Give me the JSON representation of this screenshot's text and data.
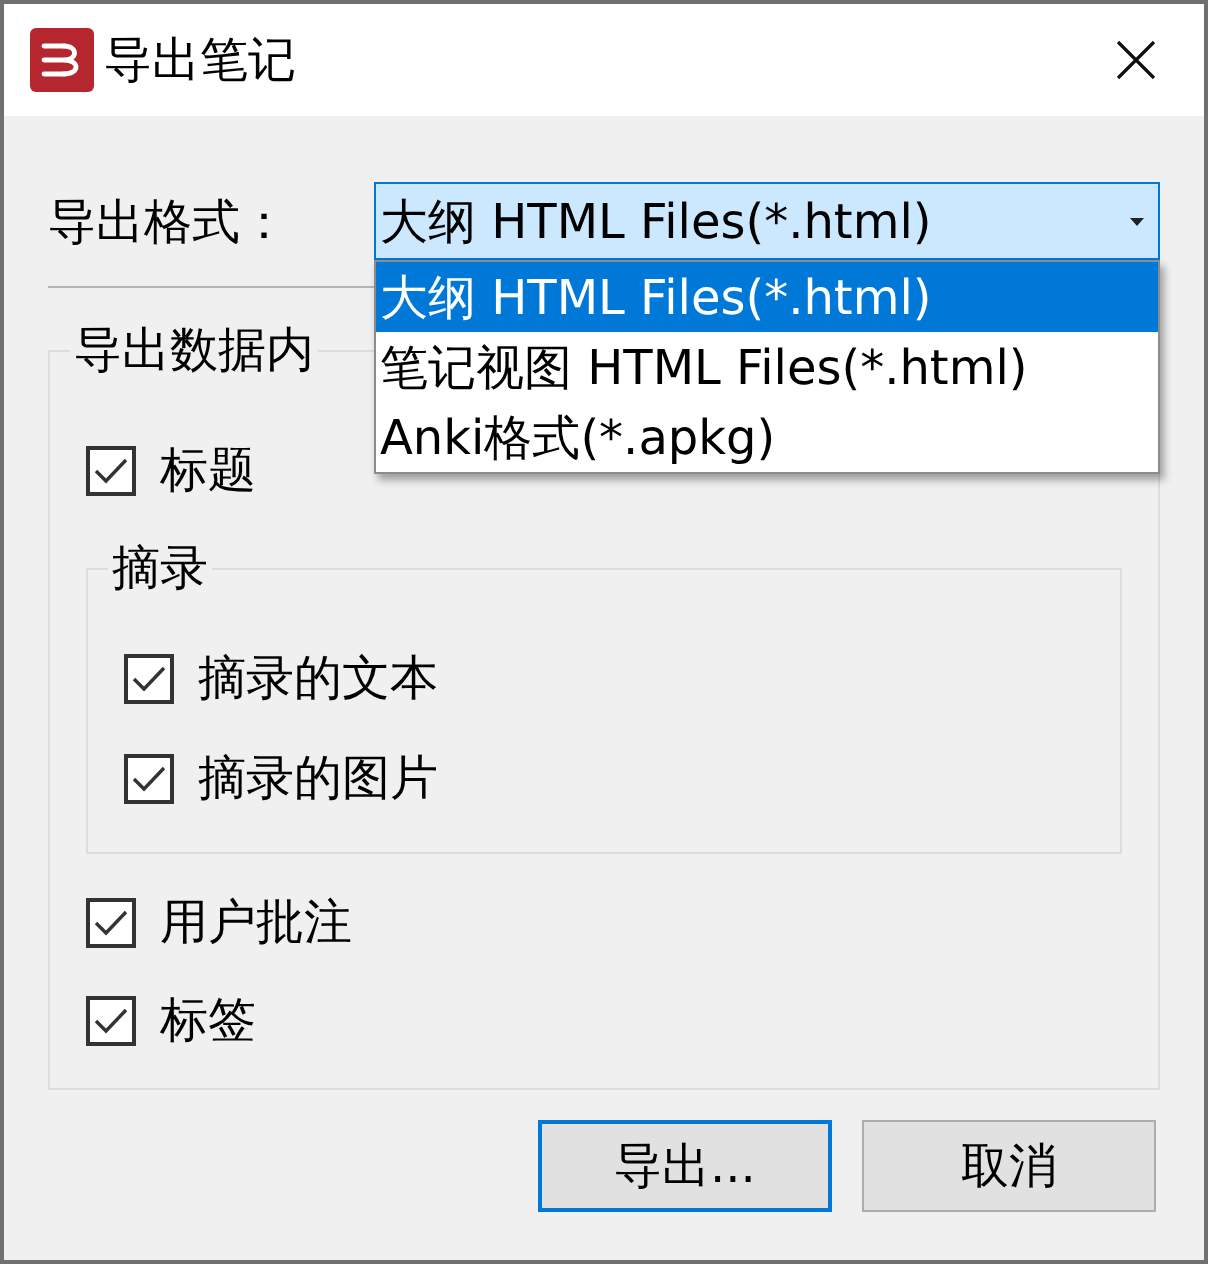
{
  "window": {
    "title": "导出笔记"
  },
  "format": {
    "label": "导出格式：",
    "value": "大纲 HTML Files(*.html)",
    "expanded": true,
    "options": [
      {
        "label": "大纲 HTML Files(*.html)",
        "selected": true
      },
      {
        "label": "笔记视图 HTML Files(*.html)",
        "selected": false
      },
      {
        "label": "Anki格式(*.apkg)",
        "selected": false
      }
    ]
  },
  "content": {
    "title": "导出数据内",
    "items": [
      {
        "kind": "checkbox",
        "label": "标题",
        "checked": true
      },
      {
        "kind": "group",
        "title": "摘录",
        "items": [
          {
            "kind": "checkbox",
            "label": "摘录的文本",
            "checked": true
          },
          {
            "kind": "checkbox",
            "label": "摘录的图片",
            "checked": true
          }
        ]
      },
      {
        "kind": "checkbox",
        "label": "用户批注",
        "checked": true
      },
      {
        "kind": "checkbox",
        "label": "标签",
        "checked": true
      }
    ]
  },
  "buttons": [
    {
      "label": "导出...",
      "default": true
    },
    {
      "label": "取消",
      "default": false
    }
  ]
}
